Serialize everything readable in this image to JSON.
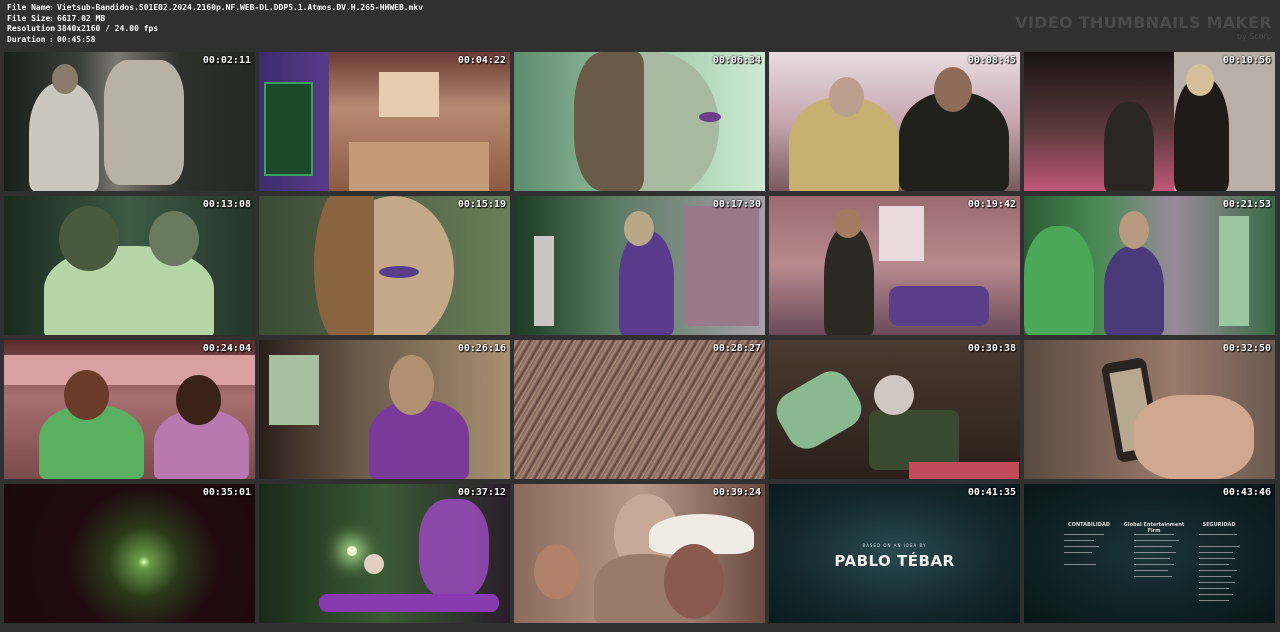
{
  "file_info": {
    "file_name": {
      "label": "File Name",
      "value": "Vietsub-Bandidos.S01E02.2024.2160p.NF.WEB-DL.DDP5.1.Atmos.DV.H.265-HHWEB.mkv"
    },
    "file_size": {
      "label": "File Size",
      "value": "6617.02 MB"
    },
    "resolution": {
      "label": "Resolution",
      "value": "3840x2160 / 24.00 fps"
    },
    "duration": {
      "label": "Duration",
      "value": "00:45:58"
    }
  },
  "branding": {
    "title": "VIDEO THUMBNAILS MAKER",
    "subtitle": "by Scorp"
  },
  "thumbnails": [
    {
      "timestamp": "00:02:11"
    },
    {
      "timestamp": "00:04:22"
    },
    {
      "timestamp": "00:06:34"
    },
    {
      "timestamp": "00:08:45"
    },
    {
      "timestamp": "00:10:56"
    },
    {
      "timestamp": "00:13:08"
    },
    {
      "timestamp": "00:15:19"
    },
    {
      "timestamp": "00:17:30"
    },
    {
      "timestamp": "00:19:42"
    },
    {
      "timestamp": "00:21:53"
    },
    {
      "timestamp": "00:24:04"
    },
    {
      "timestamp": "00:26:16"
    },
    {
      "timestamp": "00:28:27"
    },
    {
      "timestamp": "00:30:38"
    },
    {
      "timestamp": "00:32:50"
    },
    {
      "timestamp": "00:35:01"
    },
    {
      "timestamp": "00:37:12"
    },
    {
      "timestamp": "00:39:24"
    },
    {
      "timestamp": "00:41:35"
    },
    {
      "timestamp": "00:43:46"
    }
  ],
  "frame_text": {
    "title_card_small": "BASED ON AN IDEA BY",
    "title_card_name": "PABLO TÉBAR",
    "credits": {
      "col1": "CONTABILIDAD",
      "col2": "Global Entertainment Firm",
      "col3": "SEGURIDAD"
    }
  }
}
